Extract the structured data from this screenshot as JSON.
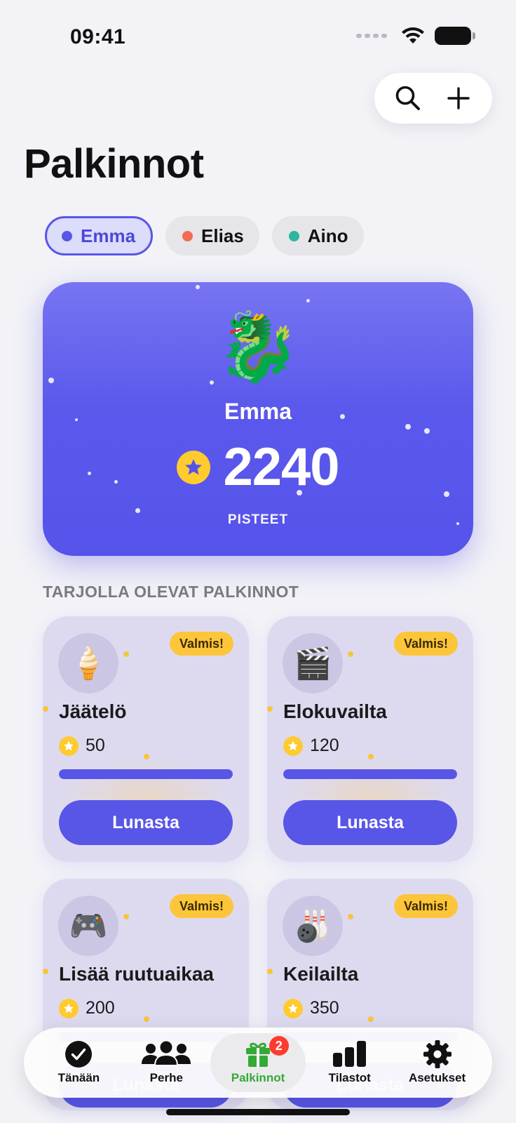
{
  "status_bar": {
    "time": "09:41"
  },
  "page": {
    "title": "Palkinnot"
  },
  "children": [
    {
      "name": "Emma",
      "color": "#5856e6",
      "active": true
    },
    {
      "name": "Elias",
      "color": "#f26b53",
      "active": false
    },
    {
      "name": "Aino",
      "color": "#2fb59b",
      "active": false
    }
  ],
  "points_card": {
    "avatar": "🐉",
    "name": "Emma",
    "points": "2240",
    "label": "PISTEET"
  },
  "rewards_section": {
    "title": "TARJOLLA OLEVAT PALKINNOT"
  },
  "rewards": [
    {
      "icon": "🍦",
      "badge": "Valmis!",
      "title": "Jäätelö",
      "cost": "50",
      "progress": 1.0,
      "button": "Lunasta"
    },
    {
      "icon": "🎬",
      "badge": "Valmis!",
      "title": "Elokuvailta",
      "cost": "120",
      "progress": 1.0,
      "button": "Lunasta"
    },
    {
      "icon": "🎮",
      "badge": "Valmis!",
      "title": "Lisää ruutuaikaa",
      "cost": "200",
      "progress": 1.0,
      "button": "Lunasta"
    },
    {
      "icon": "🎳",
      "badge": "Valmis!",
      "title": "Keilailta",
      "cost": "350",
      "progress": 1.0,
      "button": "Lunasta"
    }
  ],
  "tab_bar": {
    "tabs": [
      {
        "label": "Tänään",
        "icon": "checkmark-circle-icon"
      },
      {
        "label": "Perhe",
        "icon": "people-icon"
      },
      {
        "label": "Palkinnot",
        "icon": "gift-icon",
        "badge": "2",
        "active": true
      },
      {
        "label": "Tilastot",
        "icon": "bar-chart-icon"
      },
      {
        "label": "Asetukset",
        "icon": "gear-icon"
      }
    ]
  },
  "colors": {
    "accent": "#5856e6",
    "gold": "#ffcb2f",
    "active_tab": "#34a936",
    "badge_red": "#ff3b30"
  }
}
